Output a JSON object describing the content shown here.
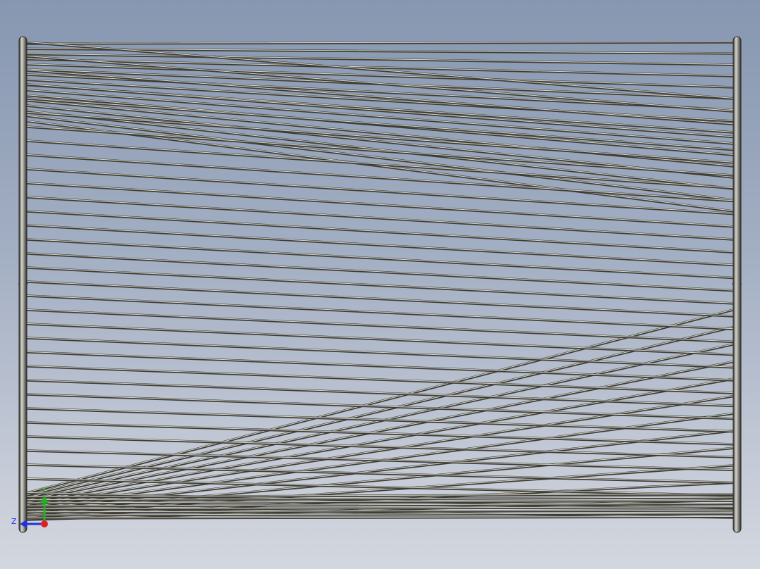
{
  "viewport": {
    "background_top": "#8797b1",
    "background_bottom": "#d3d7df",
    "model": "hyperboloid-rod-structure"
  },
  "triad": {
    "y_label": "Y",
    "z_label": "Z",
    "y_color": "#1fb51f",
    "z_color": "#2233dd",
    "x_color": "#e02020"
  },
  "colors": {
    "rod_dark": "#3d3d36",
    "rod_light": "#cfcfc6",
    "post_dark": "#2e2e2a",
    "post_light": "#d7d7d0"
  }
}
